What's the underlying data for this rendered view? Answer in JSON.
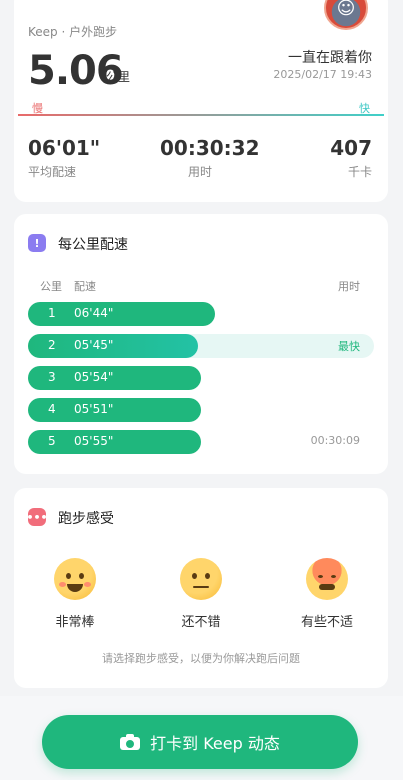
{
  "summary": {
    "brand": "Keep · 户外跑步",
    "distance": "5.06",
    "distance_unit": "公里",
    "motto": "一直在跟着你",
    "datetime": "2025/02/17 19:43",
    "slow_label": "慢",
    "fast_label": "快",
    "stats": [
      {
        "value": "06'01\"",
        "label": "平均配速"
      },
      {
        "value": "00:30:32",
        "label": "用时"
      },
      {
        "value": "407",
        "label": "千卡"
      }
    ]
  },
  "pace_section": {
    "title": "每公里配速",
    "col_km": "公里",
    "col_pace": "配速",
    "col_time": "用时",
    "rows": [
      {
        "km": "1",
        "pace": "06'44\"",
        "fraction": 0.54,
        "tag": ""
      },
      {
        "km": "2",
        "pace": "05'45\"",
        "fraction": 0.49,
        "tag": "最快"
      },
      {
        "km": "3",
        "pace": "05'54\"",
        "fraction": 0.5,
        "tag": ""
      },
      {
        "km": "4",
        "pace": "05'51\"",
        "fraction": 0.5,
        "tag": ""
      },
      {
        "km": "5",
        "pace": "05'55\"",
        "fraction": 0.5,
        "tag": ""
      }
    ],
    "total_time": "00:30:09"
  },
  "feeling_section": {
    "title": "跑步感受",
    "options": [
      {
        "label": "非常棒",
        "icon": "grin-face-icon"
      },
      {
        "label": "还不错",
        "icon": "neutral-face-icon"
      },
      {
        "label": "有些不适",
        "icon": "sweating-face-icon"
      }
    ],
    "hint": "请选择跑步感受，以便为你解决跑后问题"
  },
  "checkin_button": {
    "label": "打卡到 Keep 动态",
    "icon": "camera-icon"
  },
  "colors": {
    "accent": "#1fb77d",
    "fastest_track": "#e6f7f4",
    "slow": "#e96a6a",
    "fast": "#3fc8c6"
  }
}
